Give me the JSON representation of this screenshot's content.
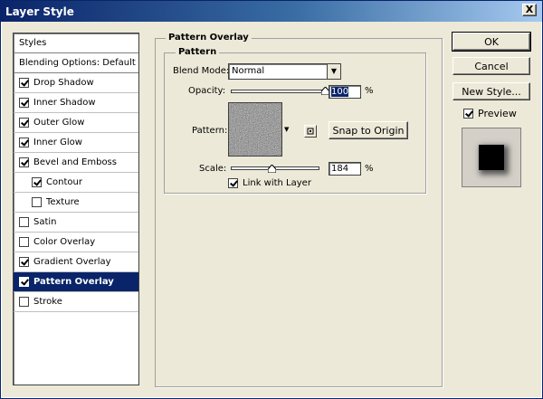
{
  "window": {
    "title": "Layer Style",
    "close": "X"
  },
  "styles_list": {
    "header": "Styles",
    "blending": "Blending Options: Default",
    "items": [
      {
        "label": "Drop Shadow",
        "checked": true
      },
      {
        "label": "Inner Shadow",
        "checked": true
      },
      {
        "label": "Outer Glow",
        "checked": true
      },
      {
        "label": "Inner Glow",
        "checked": true
      },
      {
        "label": "Bevel and Emboss",
        "checked": true
      },
      {
        "label": "Contour",
        "checked": true
      },
      {
        "label": "Texture",
        "checked": false
      },
      {
        "label": "Satin",
        "checked": false
      },
      {
        "label": "Color Overlay",
        "checked": false
      },
      {
        "label": "Gradient Overlay",
        "checked": true
      },
      {
        "label": "Pattern Overlay",
        "checked": true
      },
      {
        "label": "Stroke",
        "checked": false
      }
    ]
  },
  "panel": {
    "title": "Pattern Overlay",
    "group_title": "Pattern",
    "blend_mode_label": "Blend Mode:",
    "blend_mode_value": "Normal",
    "opacity_label": "Opacity:",
    "opacity_value": "100",
    "opacity_fraction": 1.0,
    "opacity_unit": "%",
    "pattern_label": "Pattern:",
    "snap_button": "Snap to Origin",
    "scale_label": "Scale:",
    "scale_value": "184",
    "scale_fraction": 0.46,
    "scale_unit": "%",
    "link_label": "Link with Layer",
    "link_checked": true
  },
  "buttons": {
    "ok": "OK",
    "cancel": "Cancel",
    "new_style": "New Style...",
    "preview_label": "Preview",
    "preview_checked": true
  }
}
